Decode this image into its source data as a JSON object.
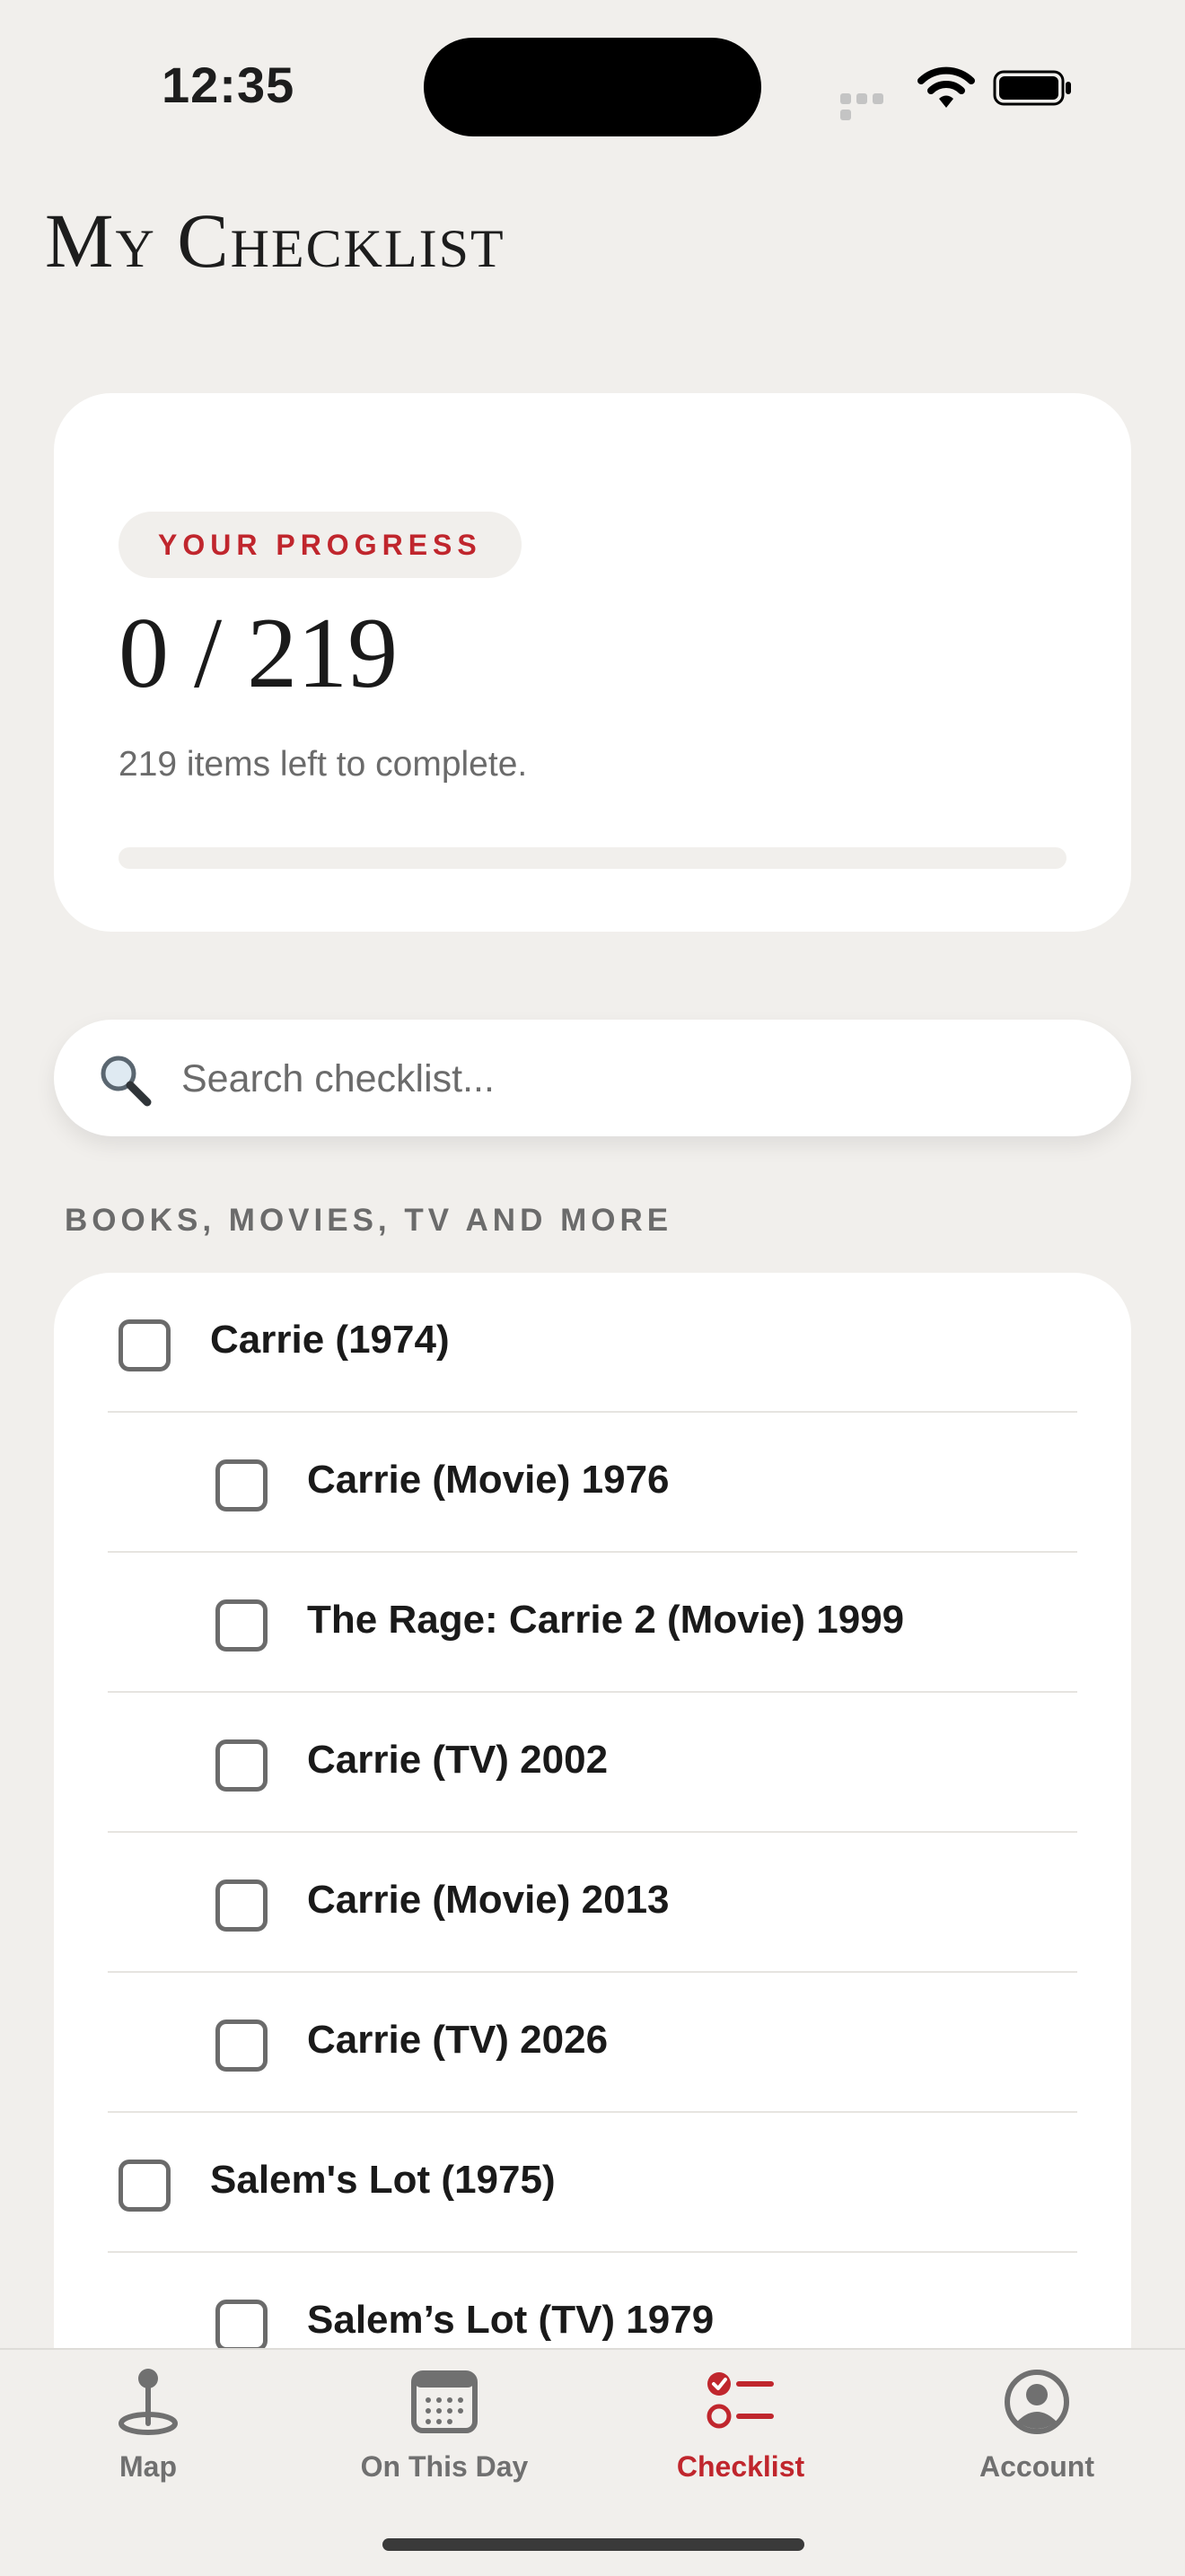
{
  "status_bar": {
    "time": "12:35"
  },
  "header": {
    "title": "My Checklist"
  },
  "progress": {
    "pill_label": "YOUR PROGRESS",
    "count_text": "0 / 219",
    "completed": 0,
    "total": 219,
    "remaining_text": "219 items left to complete.",
    "fraction": 0
  },
  "search": {
    "placeholder": "Search checklist...",
    "value": ""
  },
  "section": {
    "title": "BOOKS, MOVIES, TV AND MORE"
  },
  "checklist": {
    "items": [
      {
        "label": "Carrie (1974)",
        "checked": false,
        "level": "parent"
      },
      {
        "label": "Carrie (Movie) 1976",
        "checked": false,
        "level": "child"
      },
      {
        "label": "The Rage: Carrie 2 (Movie) 1999",
        "checked": false,
        "level": "child"
      },
      {
        "label": "Carrie (TV) 2002",
        "checked": false,
        "level": "child"
      },
      {
        "label": "Carrie (Movie) 2013",
        "checked": false,
        "level": "child"
      },
      {
        "label": "Carrie (TV) 2026",
        "checked": false,
        "level": "child"
      },
      {
        "label": "Salem's Lot (1975)",
        "checked": false,
        "level": "parent"
      },
      {
        "label": "Salem’s Lot (TV) 1979",
        "checked": false,
        "level": "child"
      }
    ]
  },
  "tabs": [
    {
      "label": "Map",
      "icon": "map-pin-icon",
      "active": false
    },
    {
      "label": "On This Day",
      "icon": "calendar-icon",
      "active": false
    },
    {
      "label": "Checklist",
      "icon": "checklist-icon",
      "active": true
    },
    {
      "label": "Account",
      "icon": "account-icon",
      "active": false
    }
  ],
  "colors": {
    "accent": "#c0262d",
    "background": "#f1efec",
    "card": "#ffffff",
    "muted_text": "#6b6b6b"
  }
}
